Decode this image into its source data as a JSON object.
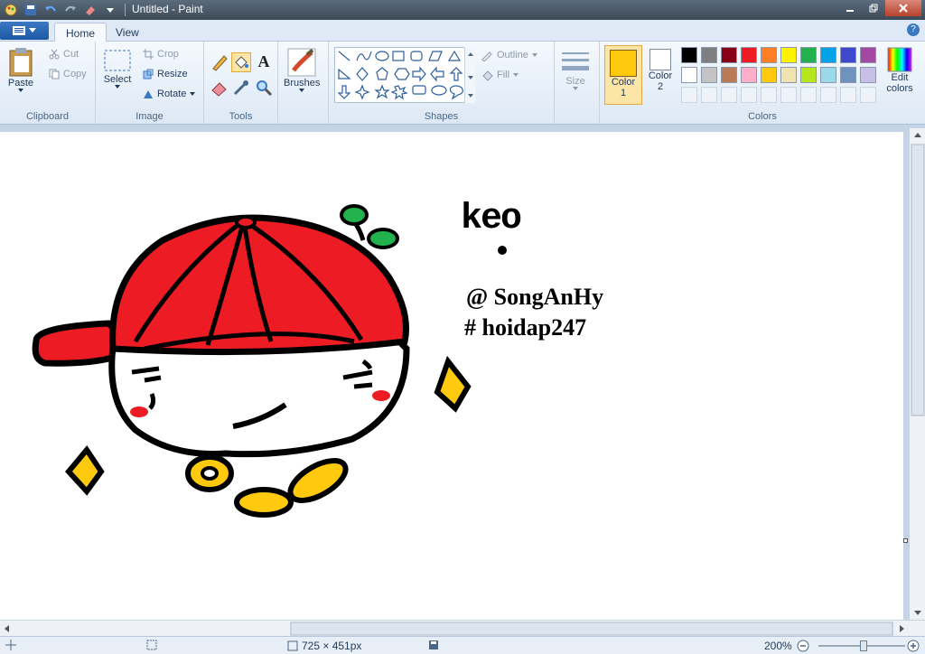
{
  "window": {
    "title": "Untitled - Paint"
  },
  "tabs": [
    {
      "label": "Home"
    },
    {
      "label": "View"
    }
  ],
  "ribbon": {
    "clipboard": {
      "label": "Clipboard",
      "paste": "Paste",
      "cut": "Cut",
      "copy": "Copy"
    },
    "image": {
      "label": "Image",
      "select": "Select",
      "crop": "Crop",
      "resize": "Resize",
      "rotate": "Rotate"
    },
    "tools": {
      "label": "Tools"
    },
    "brushes": {
      "label": "Brushes"
    },
    "shapes": {
      "label": "Shapes",
      "outline": "Outline",
      "fill": "Fill"
    },
    "size": {
      "label": "Size"
    },
    "colors": {
      "label": "Colors",
      "color1": "Color\n1",
      "color1_a": "Color",
      "color1_b": "1",
      "color2_a": "Color",
      "color2_b": "2",
      "edit_a": "Edit",
      "edit_b": "colors",
      "color1_value": "#ffc90e",
      "color2_value": "#ffffff",
      "palette_row1": [
        "#000000",
        "#7f7f7f",
        "#880015",
        "#ed1c24",
        "#ff7f27",
        "#fff200",
        "#22b14c",
        "#00a2e8",
        "#3f48cc",
        "#a349a4"
      ],
      "palette_row2": [
        "#ffffff",
        "#c3c3c3",
        "#b97a57",
        "#ffaec9",
        "#ffc90e",
        "#efe4b0",
        "#b5e61d",
        "#99d9ea",
        "#7092be",
        "#c8bfe7"
      ]
    }
  },
  "canvas": {
    "text_keo": "keo",
    "text_credit": "@ SongAnHy",
    "text_tag": "# hoidap247"
  },
  "status": {
    "dimensions": "725 × 451px",
    "zoom": "200%"
  }
}
